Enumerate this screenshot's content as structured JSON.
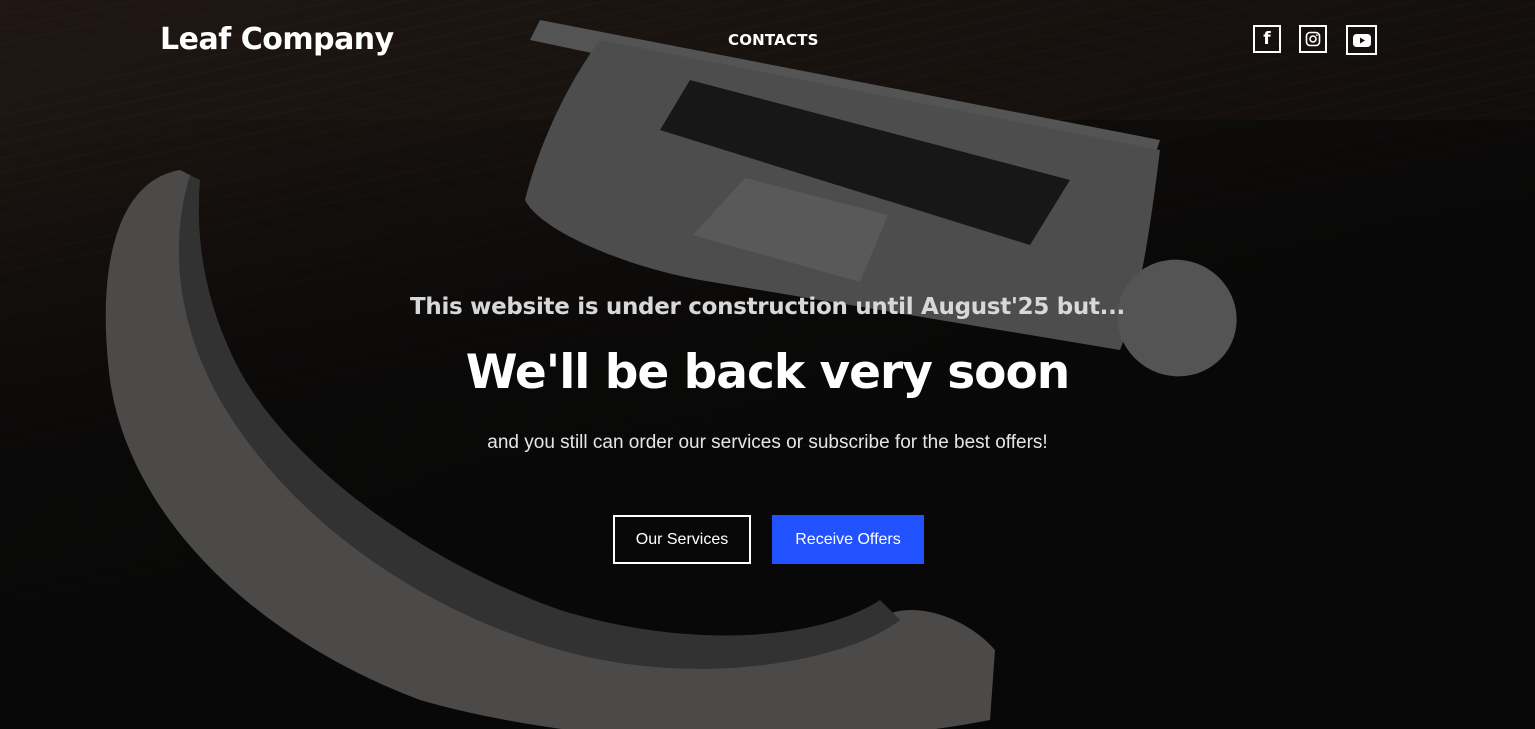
{
  "header": {
    "logo": "Leaf Company",
    "nav": [
      {
        "label": "CONTACTS"
      }
    ],
    "social": [
      {
        "icon": "facebook-icon",
        "glyph": "f"
      },
      {
        "icon": "instagram-icon"
      },
      {
        "icon": "youtube-icon"
      }
    ]
  },
  "hero": {
    "subtitle": "This website is under construction until August'25 but...",
    "title": "We'll be back very soon",
    "text": "and you still can order our services or subscribe for the best offers!",
    "buttons": {
      "services": "Our Services",
      "offers": "Receive Offers"
    }
  },
  "colors": {
    "accent": "#2251ff",
    "text": "#ffffff",
    "overlay": "#000000"
  }
}
